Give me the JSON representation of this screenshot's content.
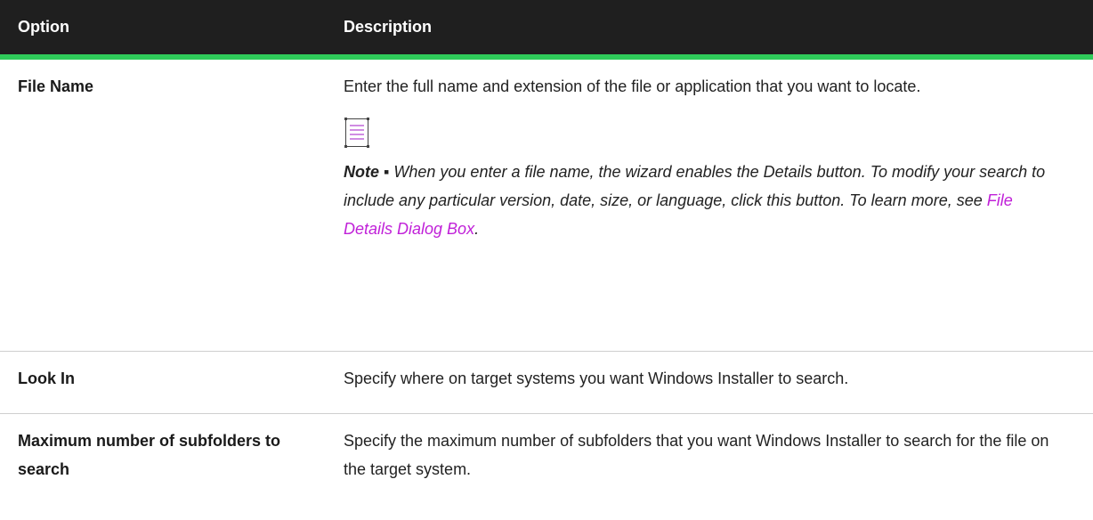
{
  "table": {
    "headers": {
      "option": "Option",
      "description": "Description"
    },
    "rows": [
      {
        "option": "File Name",
        "description": "Enter the full name and extension of the file or application that you want to locate.",
        "note": {
          "icon": "note-icon",
          "lead": "Note ▪",
          "text": " When you enter a file name, the wizard enables the Details button. To modify your search to include any particular version, date, size, or language, click this button. To learn more, see ",
          "link": "File Details Dialog Box",
          "end": "."
        }
      },
      {
        "option": "Look In",
        "description": "Specify where on target systems you want Windows Installer to search."
      },
      {
        "option": "Maximum number of subfolders to search",
        "description": "Specify the maximum number of subfolders that you want Windows Installer to search for the file on the target system."
      }
    ]
  },
  "colors": {
    "header_bg": "#1f1f1f",
    "header_accent": "#2fcb5a",
    "link": "#c020d8"
  }
}
